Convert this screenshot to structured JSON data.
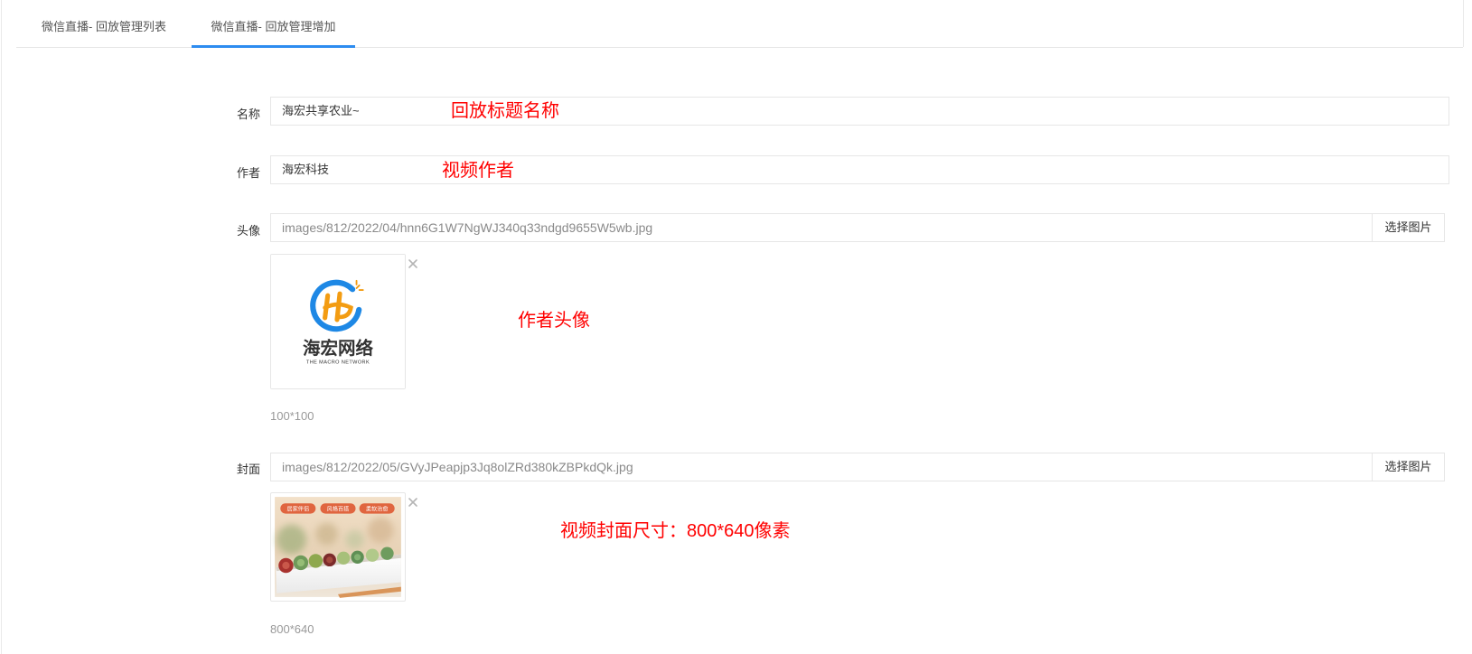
{
  "tabs": [
    {
      "label": "微信直播- 回放管理列表",
      "active": false
    },
    {
      "label": "微信直播- 回放管理增加",
      "active": true
    }
  ],
  "form": {
    "name": {
      "label": "名称",
      "value": "海宏共享农业~",
      "note": "回放标题名称"
    },
    "author": {
      "label": "作者",
      "value": "海宏科技",
      "note": "视频作者"
    },
    "avatar": {
      "label": "头像",
      "value": "images/812/2022/04/hnn6G1W7NgWJ340q33ndgd9655W5wb.jpg",
      "button": "选择图片",
      "size_hint": "100*100",
      "note": "作者头像",
      "logo_name": "海宏网络",
      "logo_sub": "THE MACRO NETWORK",
      "remove_icon": "close-icon"
    },
    "cover": {
      "label": "封面",
      "value": "images/812/2022/05/GVyJPeapjp3Jq8olZRd380kZBPkdQk.jpg",
      "button": "选择图片",
      "size_hint": "800*640",
      "note": "视频封面尺寸：800*640像素",
      "tags": [
        "居家伴侣",
        "风格百搭",
        "柔软治愈"
      ],
      "remove_icon": "close-icon"
    }
  },
  "colors": {
    "accent": "#2d8cf0",
    "annotation": "#ff0000",
    "border": "#e6e6e6",
    "logo_blue": "#1e88e5",
    "logo_orange": "#f39c12"
  }
}
